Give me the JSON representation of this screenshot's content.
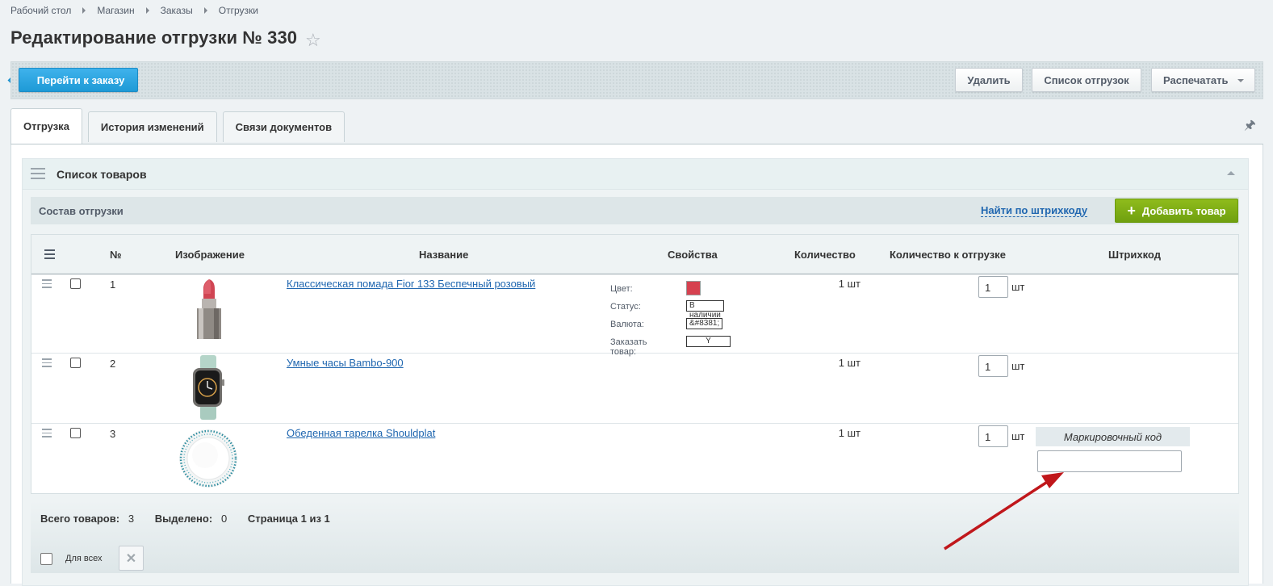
{
  "breadcrumb": [
    "Рабочий стол",
    "Магазин",
    "Заказы",
    "Отгрузки"
  ],
  "page_title": "Редактирование отгрузки № 330",
  "toolbar": {
    "back_label": "Перейти к заказу",
    "delete_label": "Удалить",
    "list_label": "Список отгрузок",
    "print_label": "Распечатать"
  },
  "tabs": [
    "Отгрузка",
    "История изменений",
    "Связи документов"
  ],
  "section": {
    "title": "Список товаров",
    "subtitle": "Состав отгрузки",
    "barcode_link": "Найти по штрихкоду",
    "add_label": "Добавить товар"
  },
  "columns": [
    "№",
    "Изображение",
    "Название",
    "Свойства",
    "Количество",
    "Количество к отгрузке",
    "Штрихкод"
  ],
  "rows": [
    {
      "num": "1",
      "name": "Классическая помада Fior 133 Беспечный розовый",
      "qty": "1 шт",
      "ship_qty": "1",
      "unit": "шт",
      "props": [
        {
          "label": "Цвет:",
          "value": "",
          "color": "#d6414f"
        },
        {
          "label": "Статус:",
          "value": "В наличии"
        },
        {
          "label": "Валюта:",
          "value": "&#8381;"
        },
        {
          "label": "Заказать товар:",
          "value": "Y"
        }
      ]
    },
    {
      "num": "2",
      "name": "Умные часы Bambo-900",
      "qty": "1 шт",
      "ship_qty": "1",
      "unit": "шт"
    },
    {
      "num": "3",
      "name": "Обеденная тарелка Shouldplat",
      "qty": "1 шт",
      "ship_qty": "1",
      "unit": "шт",
      "marking_code_label": "Маркировочный код"
    }
  ],
  "footer": {
    "total_label": "Всего товаров:",
    "total_value": "3",
    "selected_label": "Выделено:",
    "selected_value": "0",
    "page_text": "Страница 1 из 1",
    "for_all_label": "Для всех"
  },
  "colors": {
    "accent_blue": "#1e9ad6",
    "add_green": "#7aae14",
    "link": "#2067b0",
    "annotation_arrow": "#c0171b"
  }
}
